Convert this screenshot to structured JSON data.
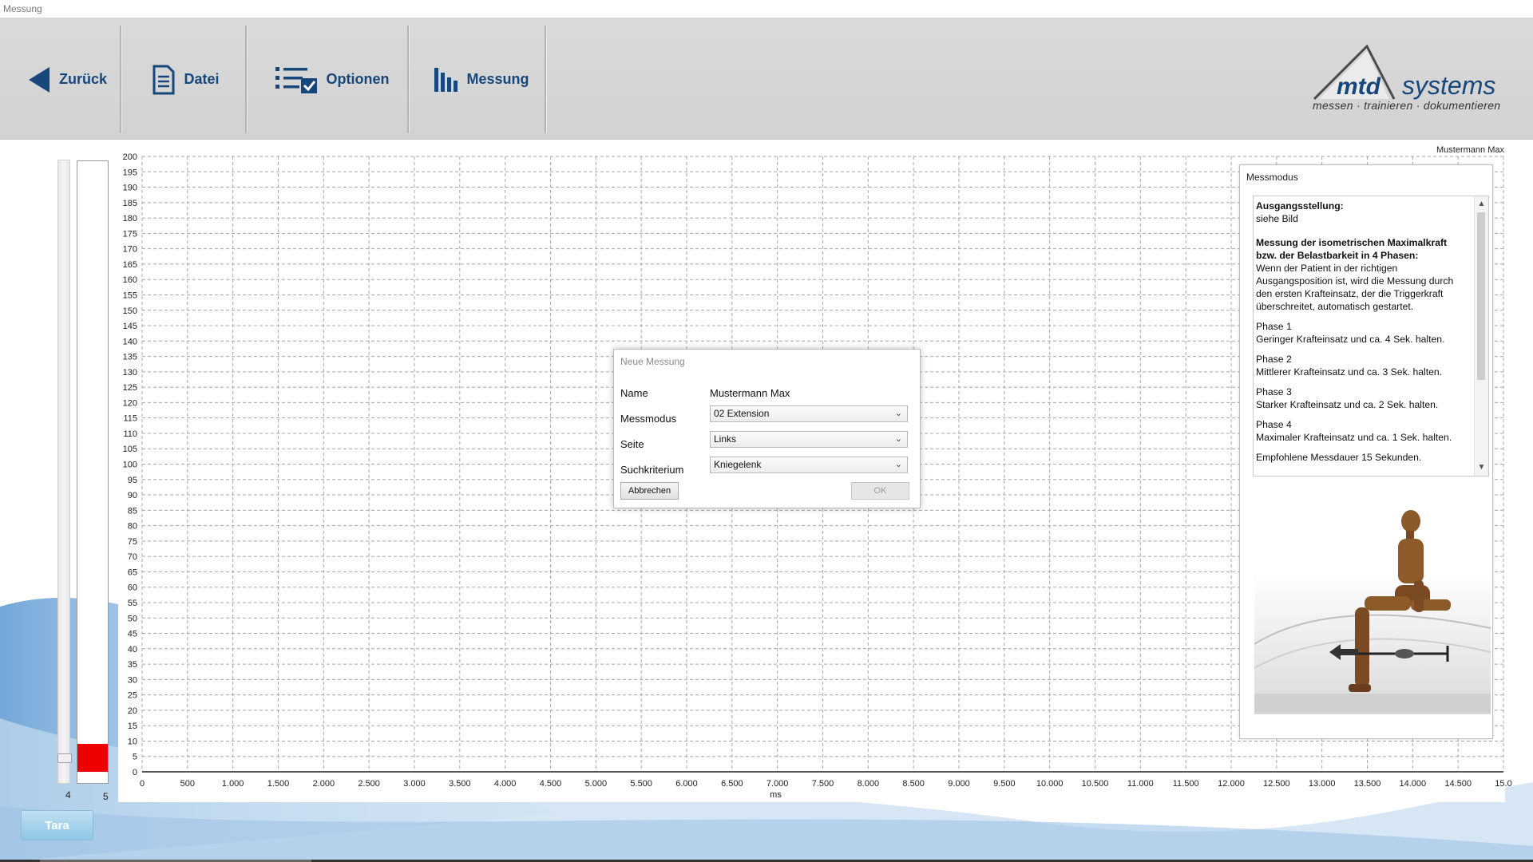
{
  "window": {
    "title": "Messung"
  },
  "toolbar": {
    "back_label": "Zurück",
    "file_label": "Datei",
    "options_label": "Optionen",
    "measure_label": "Messung"
  },
  "logo": {
    "brand_left": "mtd",
    "brand_right": "systems",
    "tagline": "messen · trainieren · dokumentieren"
  },
  "patient": {
    "name": "Mustermann Max"
  },
  "meter": {
    "left_label": "4",
    "right_label": "5",
    "level": 5
  },
  "tara": {
    "label": "Tara"
  },
  "colors": {
    "accent": "#17477a",
    "meter_fill": "#ee0000",
    "tara": "#a6d3ee",
    "grid": "#9a9a9a"
  },
  "chart_data": {
    "type": "line",
    "title": "",
    "xlabel": "ms",
    "ylabel": "",
    "xlim": [
      0,
      15000
    ],
    "ylim": [
      0,
      200
    ],
    "x_ticks": [
      0,
      500,
      1000,
      1500,
      2000,
      2500,
      3000,
      3500,
      4000,
      4500,
      5000,
      5500,
      6000,
      6500,
      7000,
      7500,
      8000,
      8500,
      9000,
      9500,
      10000,
      10500,
      11000,
      11500,
      12000,
      12500,
      13000,
      13500,
      14000,
      14500,
      15000
    ],
    "x_tick_labels": [
      "0",
      "500",
      "1.000",
      "1.500",
      "2.000",
      "2.500",
      "3.000",
      "3.500",
      "4.000",
      "4.500",
      "5.000",
      "5.500",
      "6.000",
      "6.500",
      "7.000",
      "7.500",
      "8.000",
      "8.500",
      "9.000",
      "9.500",
      "10.000",
      "10.500",
      "11.000",
      "11.500",
      "12.000",
      "12.500",
      "13.000",
      "13.500",
      "14.000",
      "14.500",
      "15.0"
    ],
    "y_ticks": [
      0,
      5,
      10,
      15,
      20,
      25,
      30,
      35,
      40,
      45,
      50,
      55,
      60,
      65,
      70,
      75,
      80,
      85,
      90,
      95,
      100,
      105,
      110,
      115,
      120,
      125,
      130,
      135,
      140,
      145,
      150,
      155,
      160,
      165,
      170,
      175,
      180,
      185,
      190,
      195,
      200
    ],
    "grid": true,
    "series": []
  },
  "panel": {
    "title": "Messmodus",
    "heading1": "Ausgangsstellung:",
    "text1": "siehe Bild",
    "heading2": "Messung der isometrischen Maximalkraft bzw. der Belastbarkeit in 4 Phasen:",
    "text2": "Wenn der Patient in der richtigen Ausgangsposition ist, wird die Messung durch den ersten Krafteinsatz, der die Triggerkraft überschreitet, automatisch gestartet.",
    "phase1_title": "Phase 1",
    "phase1_text": "Geringer Krafteinsatz und ca. 4 Sek. halten.",
    "phase2_title": "Phase 2",
    "phase2_text": "Mittlerer Krafteinsatz  und ca. 3 Sek. halten.",
    "phase3_title": "Phase 3",
    "phase3_text": "Starker Krafteinsatz und ca. 2 Sek. halten.",
    "phase4_title": "Phase 4",
    "phase4_text": "Maximaler Krafteinsatz und ca. 1 Sek. halten.",
    "footer": "Empfohlene Messdauer 15 Sekunden."
  },
  "dialog": {
    "title": "Neue Messung",
    "name_label": "Name",
    "name_value": "Mustermann Max",
    "mode_label": "Messmodus",
    "mode_value": "02 Extension",
    "side_label": "Seite",
    "side_value": "Links",
    "criterion_label": "Suchkriterium",
    "criterion_value": "Kniegelenk",
    "cancel_label": "Abbrechen",
    "ok_label": "OK"
  }
}
